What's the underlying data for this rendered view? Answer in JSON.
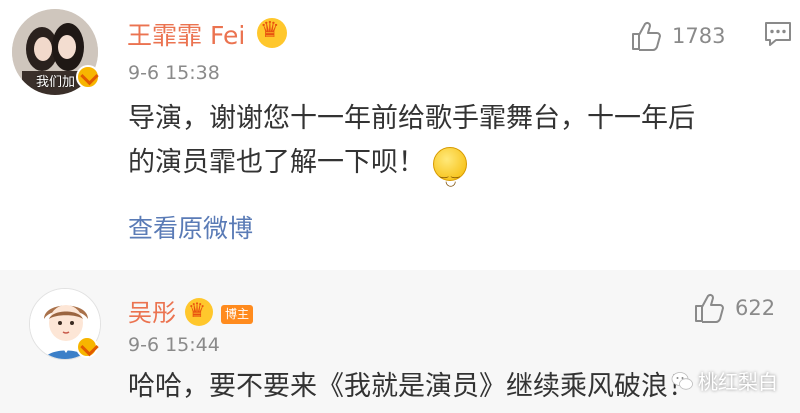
{
  "comments": [
    {
      "username": "王霏霏 Fei",
      "avatar_caption": "我们加",
      "timestamp": "9-6 15:38",
      "likes": "1783",
      "text_line1": "导演，谢谢您十一年前给歌手霏舞台，十一年后",
      "text_line2": "的演员霏也了解一下呗！",
      "view_link": "查看原微博",
      "icons": [
        "thumbs-up-icon",
        "comment-icon",
        "crown-icon",
        "verified-icon",
        "smile-emoji-icon"
      ]
    },
    {
      "username": "吴彤",
      "role_badge": "博主",
      "timestamp": "9-6 15:44",
      "likes": "622",
      "text": "哈哈，要不要来《我就是演员》继续乘风破浪！",
      "icons": [
        "thumbs-up-icon",
        "crown-icon",
        "verified-icon"
      ]
    }
  ],
  "watermark": "桃红梨白",
  "colors": {
    "username": "#eb7350",
    "link": "#5a7bb6",
    "meta": "#8a8a8a",
    "body": "#333333",
    "reply_bg": "#f7f7f7"
  }
}
